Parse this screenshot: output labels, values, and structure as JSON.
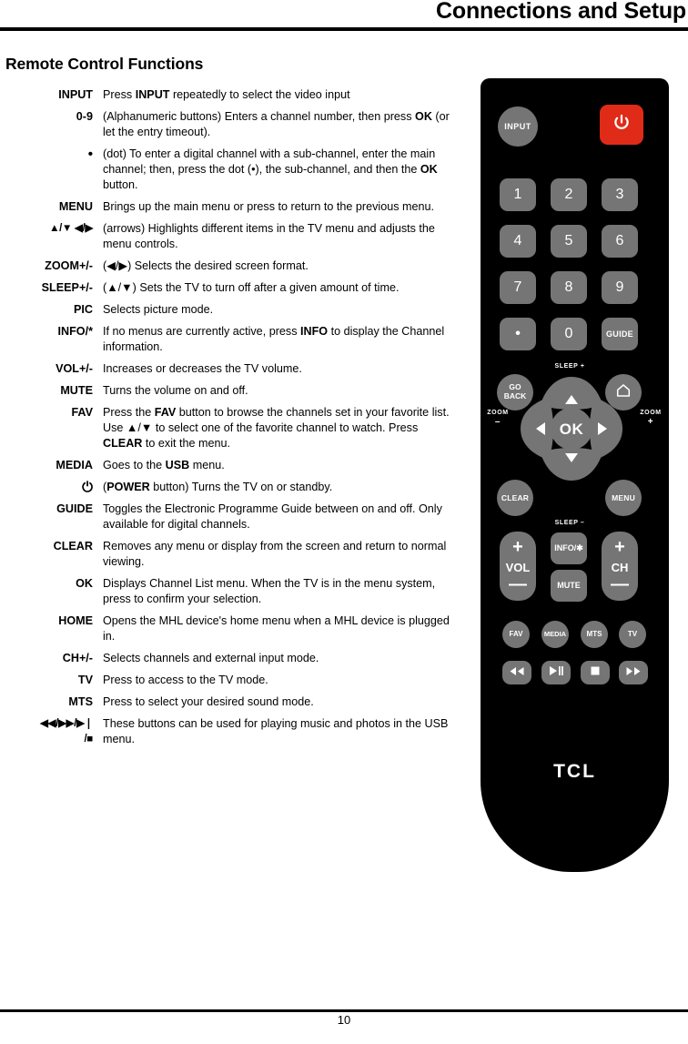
{
  "header": {
    "title": "Connections and Setup"
  },
  "section": {
    "title": "Remote Control Functions"
  },
  "footer": {
    "page_number": "10"
  },
  "functions": [
    {
      "key": "INPUT",
      "desc_html": "Press <b>INPUT</b> repeatedly to select the video input"
    },
    {
      "key": "0-9",
      "desc_html": "(Alphanumeric buttons) Enters a channel number, then press <b>OK</b> (or let the entry timeout)."
    },
    {
      "key": "•",
      "desc_html": "(dot) To enter a digital channel with a sub-channel, enter the main channel; then, press the dot (•), the sub-channel, and then the <b>OK</b> button."
    },
    {
      "key": "MENU",
      "desc_html": "Brings up the main menu or press to return to the previous menu."
    },
    {
      "key": "▲/▼ ◀/▶",
      "desc_html": "(arrows) Highlights different items in the TV menu and adjusts the menu controls."
    },
    {
      "key": "ZOOM+/-",
      "desc_html": "(◀/▶) Selects the desired screen format."
    },
    {
      "key": "SLEEP+/-",
      "desc_html": "(▲/▼) Sets the TV to turn off after a given amount of time."
    },
    {
      "key": "PIC",
      "desc_html": "Selects picture mode."
    },
    {
      "key": "INFO/*",
      "desc_html": "If no menus are currently active, press <b>INFO</b> to display the Channel information."
    },
    {
      "key": "VOL+/-",
      "desc_html": "Increases or decreases the TV volume."
    },
    {
      "key": "MUTE",
      "desc_html": "Turns the volume on and off."
    },
    {
      "key": "FAV",
      "desc_html": "Press the <b>FAV</b> button to browse the channels set in your favorite list. Use ▲/▼ to select one of the favorite channel to watch. Press <b>CLEAR</b> to exit the menu."
    },
    {
      "key": "MEDIA",
      "desc_html": "Goes to the <b>USB</b> menu."
    },
    {
      "key": "⏻",
      "desc_html": "(<b>POWER</b> button) Turns the TV on or standby."
    },
    {
      "key": "GUIDE",
      "desc_html": "Toggles the Electronic Programme Guide between on and off. Only available for digital channels."
    },
    {
      "key": "CLEAR",
      "desc_html": "Removes any menu or display from the screen and return to normal viewing."
    },
    {
      "key": "OK",
      "desc_html": "Displays Channel List menu. When the TV is in the menu system, press to confirm your selection."
    },
    {
      "key": "HOME",
      "desc_html": "Opens the MHL device's home menu when a MHL device is plugged in."
    },
    {
      "key": "CH+/-",
      "desc_html": "Selects channels and external input mode."
    },
    {
      "key": "TV",
      "desc_html": "Press to access to the TV mode."
    },
    {
      "key": "MTS",
      "desc_html": "Press to select your desired sound mode."
    },
    {
      "key": "◀◀/▶▶/▶❘\n/■",
      "desc_html": "These buttons can be used for playing music and photos in the USB menu."
    }
  ],
  "remote": {
    "brand": "TCL",
    "colors": {
      "body": "#000000",
      "button": "#757575",
      "power": "#e02b18",
      "label": "#ffffff"
    },
    "buttons": {
      "input": "INPUT",
      "power_icon": "power-icon",
      "num_1": "1",
      "num_2": "2",
      "num_3": "3",
      "num_4": "4",
      "num_5": "5",
      "num_6": "6",
      "num_7": "7",
      "num_8": "8",
      "num_9": "9",
      "dot": "•",
      "num_0": "0",
      "guide": "GUIDE",
      "go_back": "GO\nBACK",
      "home_icon": "home-icon",
      "ok": "OK",
      "clear": "CLEAR",
      "menu": "MENU",
      "info": "INFO/✱",
      "mute": "MUTE",
      "vol_name": "VOL",
      "ch_name": "CH",
      "plus": "+",
      "minus": "—",
      "fav": "FAV",
      "media": "MEDIA",
      "mts": "MTS",
      "tv": "TV",
      "rewind_icon": "rewind-icon",
      "playpause_icon": "play-pause-icon",
      "stop_icon": "stop-icon",
      "forward_icon": "fast-forward-icon"
    },
    "side_labels": {
      "sleep_plus": "SLEEP  +",
      "sleep_minus": "SLEEP  –",
      "zoom_minus_top": "ZOOM",
      "zoom_minus_sym": "–",
      "zoom_plus_top": "ZOOM",
      "zoom_plus_sym": "+"
    }
  }
}
